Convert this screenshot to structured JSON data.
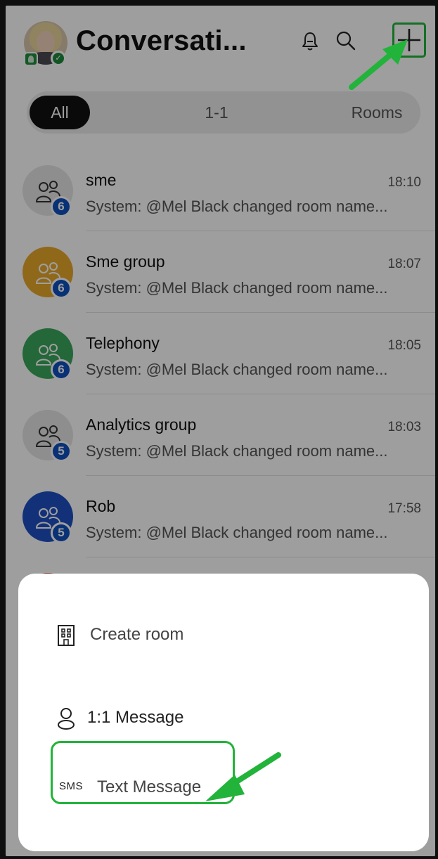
{
  "header": {
    "title": "Conversati...",
    "bell_icon": "bell-icon",
    "search_icon": "search-icon",
    "new_icon": "plus-icon"
  },
  "tabs": [
    {
      "label": "All",
      "selected": true
    },
    {
      "label": "1-1",
      "selected": false
    },
    {
      "label": "Rooms",
      "selected": false
    }
  ],
  "conversations": [
    {
      "name": "sme",
      "time": "18:10",
      "preview": "System: @Mel Black changed room name...",
      "badge": "6",
      "color": "#e6e6e6"
    },
    {
      "name": "Sme group",
      "time": "18:07",
      "preview": "System: @Mel Black changed room name...",
      "badge": "6",
      "color": "#e9a92a"
    },
    {
      "name": "Telephony",
      "time": "18:05",
      "preview": "System: @Mel Black changed room name...",
      "badge": "6",
      "color": "#3aa65c"
    },
    {
      "name": "Analytics group",
      "time": "18:03",
      "preview": "System: @Mel Black changed room name...",
      "badge": "5",
      "color": "#e6e6e6"
    },
    {
      "name": "Rob",
      "time": "17:58",
      "preview": "System: @Mel Black changed room name...",
      "badge": "5",
      "color": "#1f4fc4"
    }
  ],
  "sheet": {
    "create_room": "Create room",
    "one_to_one": "1:1 Message",
    "sms_tag": "SMS",
    "text_message": "Text Message"
  },
  "colors": {
    "annotation_green": "#22b33a",
    "badge_blue": "#0f4fbf"
  }
}
